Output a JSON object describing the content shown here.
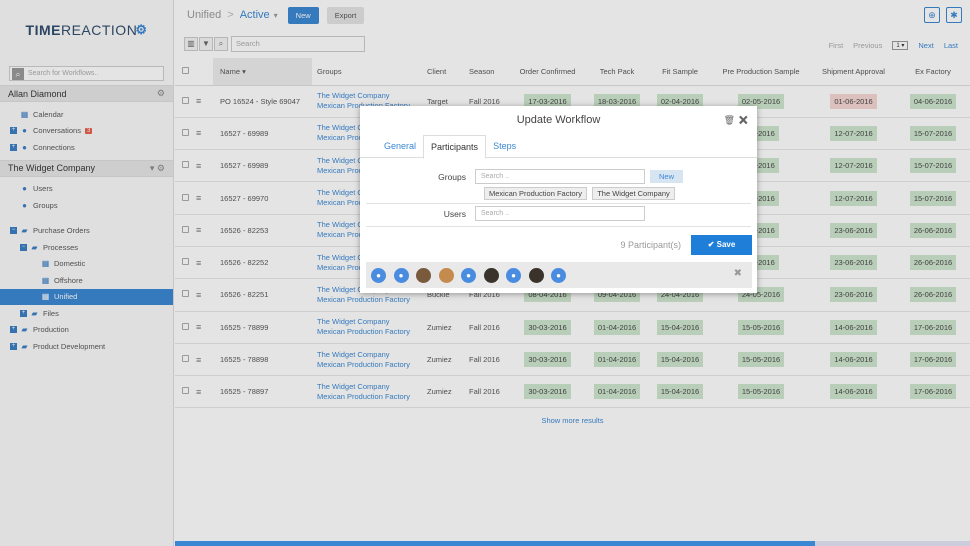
{
  "brand": {
    "part1": "TIME",
    "part2": "REACTION"
  },
  "sidebar": {
    "search_placeholder": "Search for Workflows..",
    "user": "Allan Diamond",
    "user_items": [
      {
        "label": "Calendar",
        "icon": "calendar-icon"
      },
      {
        "label": "Conversations",
        "icon": "chat-icon",
        "badge": "3"
      },
      {
        "label": "Connections",
        "icon": "people-icon"
      }
    ],
    "company": "The Widget Company",
    "company_items": [
      {
        "label": "Users",
        "icon": "user-icon"
      },
      {
        "label": "Groups",
        "icon": "group-icon"
      }
    ],
    "tree": [
      {
        "label": "Purchase Orders"
      },
      {
        "label": "Processes"
      },
      {
        "label": "Domestic"
      },
      {
        "label": "Offshore"
      },
      {
        "label": "Unified"
      },
      {
        "label": "Files"
      },
      {
        "label": "Production"
      },
      {
        "label": "Product Development"
      }
    ]
  },
  "topbar": {
    "crumb": "Unified",
    "sep": ">",
    "active": "Active",
    "caret": "▾",
    "new_label": "New",
    "export_label": "Export"
  },
  "toolbar": {
    "search_placeholder": "Search"
  },
  "pager": {
    "first": "First",
    "previous": "Previous",
    "page": "1",
    "next": "Next",
    "last": "Last"
  },
  "table": {
    "headers": [
      "Name",
      "Groups",
      "Client",
      "Season",
      "Order Confirmed",
      "Tech Pack",
      "Fit Sample",
      "Pre Production Sample",
      "Shipment Approval",
      "Ex Factory"
    ],
    "rows": [
      {
        "name": "PO 16524 - Style 69047",
        "g1": "The Widget Company",
        "g2": "Mexican Production Factory",
        "client": "Target",
        "season": "Fall 2016",
        "oc": "17-03-2016",
        "tp": "18-03-2016",
        "fs": "02-04-2016",
        "pp": "02-05-2016",
        "sa": "01-06-2016",
        "ex": "04-06-2016"
      },
      {
        "name": "16527 - 69989",
        "g1": "The Widget Company",
        "g2": "Mexican Production Factory",
        "client": "",
        "season": "",
        "oc": "",
        "tp": "",
        "fs": "",
        "pp": "06-2016",
        "sa": "12-07-2016",
        "ex": "15-07-2016"
      },
      {
        "name": "16527 - 69989",
        "g1": "The Widget Company",
        "g2": "Mexican Production Factory",
        "client": "",
        "season": "",
        "oc": "",
        "tp": "",
        "fs": "",
        "pp": "06-2016",
        "sa": "12-07-2016",
        "ex": "15-07-2016"
      },
      {
        "name": "16527 - 69970",
        "g1": "The Widget Company",
        "g2": "Mexican Production Factory",
        "client": "",
        "season": "",
        "oc": "",
        "tp": "",
        "fs": "",
        "pp": "06-2016",
        "sa": "12-07-2016",
        "ex": "15-07-2016"
      },
      {
        "name": "16526 - 82253",
        "g1": "The Widget Company",
        "g2": "Mexican Production Factory",
        "client": "",
        "season": "",
        "oc": "",
        "tp": "",
        "fs": "",
        "pp": "05-2016",
        "sa": "23-06-2016",
        "ex": "26-06-2016"
      },
      {
        "name": "16526 - 82252",
        "g1": "The Widget Company",
        "g2": "Mexican Production Factory",
        "client": "",
        "season": "",
        "oc": "",
        "tp": "",
        "fs": "",
        "pp": "05-2016",
        "sa": "23-06-2016",
        "ex": "26-06-2016"
      },
      {
        "name": "16526 - 82251",
        "g1": "The Widget Company",
        "g2": "Mexican Production Factory",
        "client": "Buckle",
        "season": "Fall 2016",
        "oc": "08-04-2016",
        "tp": "09-04-2016",
        "fs": "24-04-2016",
        "pp": "24-05-2016",
        "sa": "23-06-2016",
        "ex": "26-06-2016"
      },
      {
        "name": "16525 - 78899",
        "g1": "The Widget Company",
        "g2": "Mexican Production Factory",
        "client": "Zumiez",
        "season": "Fall 2016",
        "oc": "30-03-2016",
        "tp": "01-04-2016",
        "fs": "15-04-2016",
        "pp": "15-05-2016",
        "sa": "14-06-2016",
        "ex": "17-06-2016"
      },
      {
        "name": "16525 - 78898",
        "g1": "The Widget Company",
        "g2": "Mexican Production Factory",
        "client": "Zumiez",
        "season": "Fall 2016",
        "oc": "30-03-2016",
        "tp": "01-04-2016",
        "fs": "15-04-2016",
        "pp": "15-05-2016",
        "sa": "14-06-2016",
        "ex": "17-06-2016"
      },
      {
        "name": "16525 - 78897",
        "g1": "The Widget Company",
        "g2": "Mexican Production Factory",
        "client": "Zumiez",
        "season": "Fall 2016",
        "oc": "30-03-2016",
        "tp": "01-04-2016",
        "fs": "15-04-2016",
        "pp": "15-05-2016",
        "sa": "14-06-2016",
        "ex": "17-06-2016"
      }
    ],
    "show_more": "Show more results"
  },
  "modal": {
    "title": "Update Workflow",
    "tabs": [
      "General",
      "Participants",
      "Steps"
    ],
    "groups_label": "Groups",
    "groups_placeholder": "Search ..",
    "new_label": "New",
    "group_tags": [
      "Mexican Production Factory",
      "The Widget Company"
    ],
    "users_label": "Users",
    "users_placeholder": "Search ..",
    "participant_count": "9 Participant(s)",
    "save_label": "Save",
    "avatars": [
      "user",
      "user",
      "photo",
      "photo2",
      "user",
      "photo3",
      "user",
      "photo3",
      "user"
    ]
  },
  "colors": {
    "accent": "#3a87d4",
    "success_pill": "#cfe6cf",
    "danger_pill": "#f6d7d3"
  }
}
